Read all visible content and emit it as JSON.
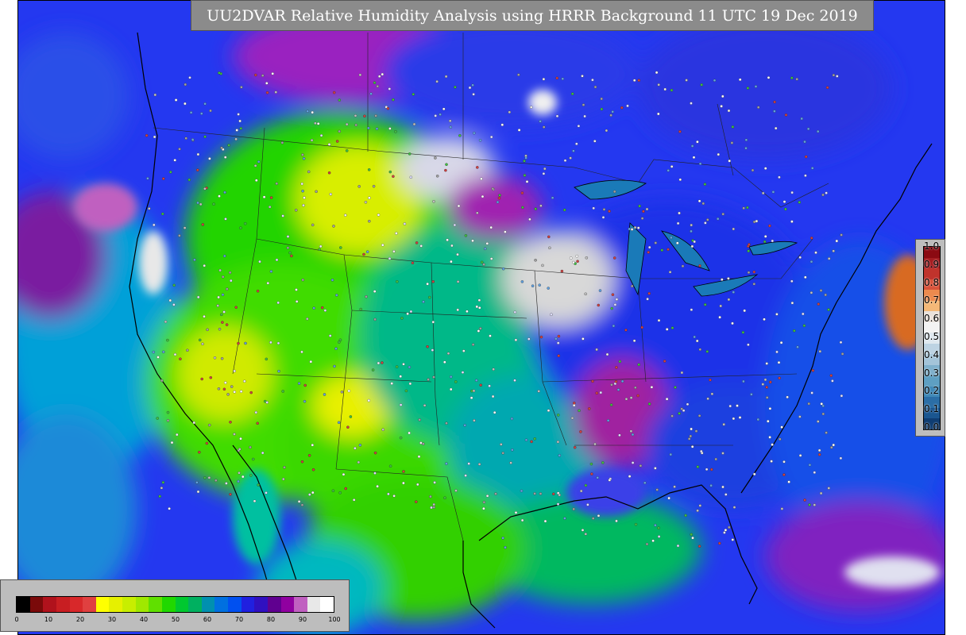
{
  "title": "UU2DVAR Relative Humidity Analysis using HRRR Background 11 UTC 19 Dec 2019",
  "right_colorbar": {
    "ticks": [
      "1.0",
      "0.9",
      "0.8",
      "0.7",
      "0.6",
      "0.5",
      "0.4",
      "0.3",
      "0.2",
      "0.1",
      "0.0"
    ],
    "colors": [
      "#8b0a12",
      "#a51c20",
      "#c0332c",
      "#d9533b",
      "#ec8a4e",
      "#f4b877",
      "#e9e1da",
      "#f3f3f3",
      "#dfe8ef",
      "#bdd3e3",
      "#a4c4d9",
      "#7fb0cc",
      "#5e9fc2",
      "#3f88b7",
      "#2b6ea6",
      "#1a5690",
      "#0f3d72"
    ]
  },
  "bottom_colorbar": {
    "ticks": [
      "0",
      "10",
      "20",
      "30",
      "40",
      "50",
      "60",
      "70",
      "80",
      "90",
      "100"
    ],
    "colors": [
      "#000000",
      "#7a0a0a",
      "#b0121c",
      "#c81e22",
      "#d8282a",
      "#e04040",
      "#ffff00",
      "#e6f000",
      "#c8ee00",
      "#a0e800",
      "#60e000",
      "#20d800",
      "#00c830",
      "#00b060",
      "#0090b0",
      "#0070e0",
      "#0050f0",
      "#2020e0",
      "#3010c0",
      "#600090",
      "#9000a0",
      "#c060c0",
      "#e8e8e8",
      "#ffffff"
    ]
  }
}
